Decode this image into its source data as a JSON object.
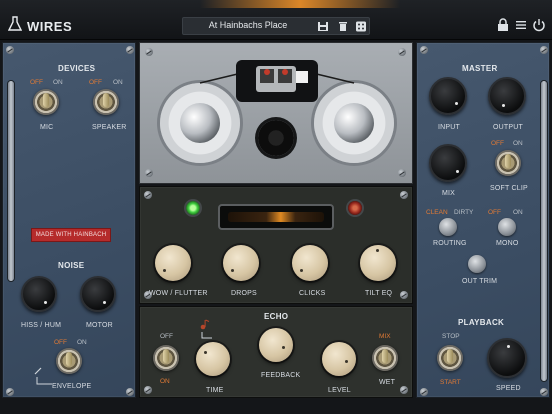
{
  "app": {
    "title": "WIRES"
  },
  "preset": {
    "name": "At Hainbachs Place"
  },
  "colors": {
    "accent_orange": "#e07a35",
    "panel_blue": "#3f5166",
    "badge_red": "#b52b2b",
    "led_green": "#3ecf3e",
    "led_red": "#9b2a1f"
  },
  "devices": {
    "title": "DEVICES",
    "mic": {
      "label": "MIC",
      "off": "OFF",
      "on": "ON"
    },
    "speaker": {
      "label": "SPEAKER",
      "off": "OFF",
      "on": "ON"
    }
  },
  "badge": {
    "text": "MADE WITH HAINBACH"
  },
  "noise": {
    "title": "NOISE",
    "hiss_hum": {
      "label": "HISS / HUM"
    },
    "motor": {
      "label": "MOTOR"
    },
    "envelope": {
      "label": "ENVELOPE",
      "off": "OFF",
      "on": "ON"
    }
  },
  "modulation": {
    "wow_flutter": {
      "label": "WOW / FLUTTER"
    },
    "drops": {
      "label": "DROPS"
    },
    "clicks": {
      "label": "CLICKS"
    },
    "tilt_eq": {
      "label": "TILT EQ"
    }
  },
  "echo": {
    "title": "ECHO",
    "toggle": {
      "off": "OFF",
      "on": "ON"
    },
    "time": {
      "label": "TIME"
    },
    "feedback": {
      "label": "FEEDBACK"
    },
    "level": {
      "label": "LEVEL"
    },
    "wet": {
      "label": "WET",
      "mix": "MIX"
    }
  },
  "master": {
    "title": "MASTER",
    "input": {
      "label": "INPUT"
    },
    "output": {
      "label": "OUTPUT"
    },
    "mix": {
      "label": "MIX"
    },
    "soft_clip": {
      "label": "SOFT CLIP",
      "off": "OFF",
      "on": "ON"
    },
    "routing": {
      "label": "ROUTING",
      "clean": "CLEAN",
      "dirty": "DIRTY"
    },
    "mono": {
      "label": "MONO",
      "off": "OFF",
      "on": "ON"
    },
    "out_trim": {
      "label": "OUT TRIM"
    }
  },
  "playback": {
    "title": "PLAYBACK",
    "stop": "STOP",
    "start": "START",
    "speed": {
      "label": "SPEED"
    }
  }
}
